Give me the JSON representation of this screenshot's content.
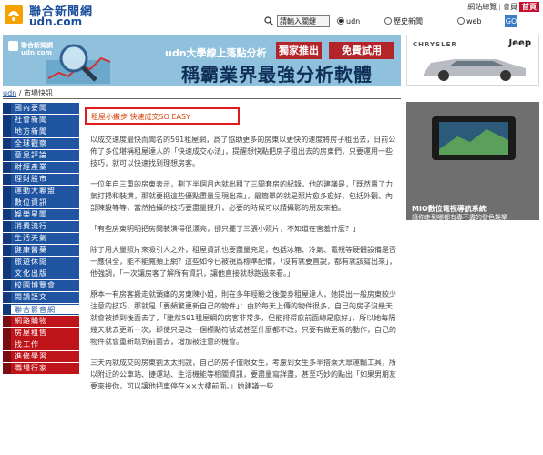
{
  "header": {
    "logo_cn": "聯合新聞網",
    "logo_en": "udn.com",
    "links": [
      "網站總覽",
      "會員"
    ],
    "home_label": "首頁"
  },
  "search": {
    "keyword_placeholder": "請輸入關鍵",
    "options": [
      "udn",
      "歷史新聞",
      "web"
    ],
    "selected_option": "udn",
    "go_label": "GO"
  },
  "banner": {
    "brand": "聯合新聞網",
    "brand_en": "udn.com",
    "line1": "udn大學線上落點分析",
    "box1": "獨家推出",
    "box2": "免費試用",
    "headline": "稱霸業界最強分析軟體"
  },
  "breadcrumb": {
    "home": "udn",
    "current": "市場快訊",
    "separator": " / "
  },
  "sidebar": {
    "items": [
      {
        "label": "國內要聞",
        "style": "blue"
      },
      {
        "label": "社會新聞",
        "style": "blue"
      },
      {
        "label": "地方新聞",
        "style": "blue"
      },
      {
        "label": "全球觀察",
        "style": "blue"
      },
      {
        "label": "意見評論",
        "style": "blue"
      },
      {
        "label": "財經產業",
        "style": "blue"
      },
      {
        "label": "理財股市",
        "style": "blue"
      },
      {
        "label": "運動大聯盟",
        "style": "blue"
      },
      {
        "label": "數位資訊",
        "style": "blue"
      },
      {
        "label": "娛樂星聞",
        "style": "blue"
      },
      {
        "label": "消費流行",
        "style": "blue"
      },
      {
        "label": "生活天氣",
        "style": "blue"
      },
      {
        "label": "健康醫藥",
        "style": "blue"
      },
      {
        "label": "旅遊休閒",
        "style": "blue"
      },
      {
        "label": "文化出版",
        "style": "blue"
      },
      {
        "label": "校園博覽會",
        "style": "blue"
      },
      {
        "label": "閱讀語文",
        "style": "blue"
      },
      {
        "label": "聯合影音網",
        "style": "white"
      },
      {
        "label": "網路購物",
        "style": "red"
      },
      {
        "label": "房屋租售",
        "style": "red"
      },
      {
        "label": "找工作",
        "style": "red"
      },
      {
        "label": "進修學習",
        "style": "red"
      },
      {
        "label": "職場行家",
        "style": "red"
      }
    ]
  },
  "article": {
    "title": "租屋小撇步 快速成交SO EASY",
    "paragraphs": [
      "以成交速度最快而聞名的591租屋網，爲了協助更多的房東以更快的速度將房子租出去，日前公佈了多位堪稱租屋達人的「快速成交心法」，提醒想快點把房子租出去的房東們，只要運用一些技巧，就可以快速找到理想房客。",
      "一位年自三重的房東表示，劃下半個月內就出租了三間套房的紀錄，他的建議是，「既然賣了力氣打掃和裝潢，那就要把這些優點盡量呈現出來」，最簡單的就是照片愈多愈好，包括外觀、內部陳設等等，當然拍攝的技巧要盡量提升，必要的時候可以請攝影的朋友來拍。",
      "「有些房東明明把房間裝潢得很漂亮，卻只擺了三張小照片，不知道在害羞什麼？」",
      "除了用大量照片來吸引人之外，租屋資訊也要盡量充足，包括冰箱、冷氣、電視等硬體設備是否一應俱全，能不能寬頻上網？這些如今已被視爲標準配備，「沒有就要直說，都有就該寫出來」，他強調，「一次讓房客了解所有資訊，讓他直接就想跑過來看。」",
      "原本一有房客搬走就頭痛的房東陳小姐，則在多年經驗之後變身租屋達人，她提出一般房東較少注意的技巧，那就是「要頻繁更新自己的物件」：由於每天上傳的物件很多，自己的房子沒幾天就會被擠到後面去了，「雖然591租屋網的房客非常多，但能排得愈前面總是愈好」，所以她每隔幾天就去更新一次，即使只是改一個標點符號或甚至什麼都不改，只要有做更新的動作，自己的物件就會重新跳到前面去，增加被注意的機會。",
      "三天內就成交的房東劉太太則說，自己的房子僅限女生，考慮到女生多半搭乘大眾運輸工具，所以附近的公車站、捷運站、生活機能等相關資訊，要盡量寫詳盡，甚至巧妙的點出「如果男朋友要來接你，可以讓他把車停在××大樓前面。」她建議一些"
    ]
  },
  "ads": {
    "car_brand1": "CHRYSLER",
    "car_brand2": "Jeep",
    "gps_line1": "MIO數位電視導航系統",
    "gps_line2": "讓你走到哪都有專不盡的發色娛樂"
  }
}
